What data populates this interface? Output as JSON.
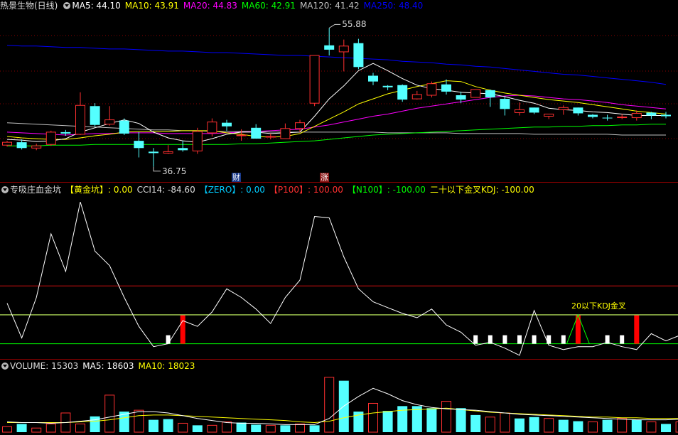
{
  "price_panel": {
    "title": "热景生物(日线)",
    "ma": [
      {
        "label": "MA5: 44.10",
        "color": "#ffffff"
      },
      {
        "label": "MA10: 43.91",
        "color": "#ffff00"
      },
      {
        "label": "MA20: 44.83",
        "color": "#ff00ff"
      },
      {
        "label": "MA60: 42.91",
        "color": "#00ff00"
      },
      {
        "label": "MA120: 41.42",
        "color": "#c0c0c0"
      },
      {
        "label": "MA250: 48.40",
        "color": "#0000ff"
      }
    ],
    "high_label": "55.88",
    "low_label": "36.75",
    "events": [
      {
        "text": "财",
        "color": "#3070ff"
      },
      {
        "text": "涨",
        "color": "#ff3030"
      }
    ]
  },
  "indicator_panel": {
    "title": "专吸庄血金坑",
    "items": [
      {
        "label": "【黄金坑】: 0.00",
        "color": "#ffff00"
      },
      {
        "label": "CCI14: -84.60",
        "color": "#dddddd"
      },
      {
        "label": "【ZERO】: 0.00",
        "color": "#00ccff"
      },
      {
        "label": "【P100】: 100.00",
        "color": "#ff3030"
      },
      {
        "label": "【N100】: -100.00",
        "color": "#00ff00"
      },
      {
        "label": "二十以下金叉KDJ: -100.00",
        "color": "#ffff00"
      }
    ],
    "annotation": "20以下KDJ金叉"
  },
  "volume_panel": {
    "title": "VOLUME: 15303",
    "ma5": "MA5: 18603",
    "ma10": "MA10: 18023"
  },
  "colors": {
    "up": "#ff3030",
    "down": "#54ffff",
    "bg": "#000000",
    "grid": "#8a0000"
  },
  "chart_data": [
    {
      "type": "candlestick",
      "candles": [
        [
          40.0,
          40.4,
          40.6,
          39.8
        ],
        [
          40.4,
          39.6,
          40.8,
          39.4
        ],
        [
          39.6,
          39.9,
          40.2,
          39.3
        ],
        [
          40.1,
          41.8,
          42.0,
          39.9
        ],
        [
          41.8,
          41.6,
          42.1,
          41.3
        ],
        [
          41.5,
          45.5,
          47.3,
          41.4
        ],
        [
          45.4,
          42.8,
          45.8,
          42.6
        ],
        [
          42.9,
          43.5,
          45.4,
          42.7
        ],
        [
          43.4,
          41.6,
          43.7,
          41.4
        ],
        [
          40.6,
          39.6,
          41.8,
          38.3
        ],
        [
          39.1,
          38.9,
          39.6,
          37.0
        ],
        [
          38.9,
          39.1,
          40.0,
          38.8
        ],
        [
          39.6,
          39.3,
          40.6,
          39.1
        ],
        [
          39.2,
          41.9,
          42.4,
          38.8
        ],
        [
          41.7,
          43.2,
          43.7,
          41.2
        ],
        [
          43.1,
          42.6,
          43.5,
          42.0
        ],
        [
          41.4,
          41.4,
          42.2,
          40.6
        ],
        [
          42.4,
          40.9,
          42.9,
          40.9
        ],
        [
          41.2,
          41.2,
          41.6,
          40.8
        ],
        [
          40.9,
          42.3,
          43.0,
          40.9
        ],
        [
          42.3,
          43.1,
          43.5,
          41.8
        ],
        [
          45.8,
          52.4,
          52.4,
          45.4
        ],
        [
          53.8,
          53.2,
          56.2,
          52.4
        ],
        [
          52.9,
          53.7,
          54.6,
          50.2
        ],
        [
          54.1,
          50.8,
          54.7,
          50.5
        ],
        [
          49.6,
          48.8,
          50.0,
          48.3
        ],
        [
          48.2,
          48.0,
          48.3,
          47.6
        ],
        [
          48.3,
          46.3,
          48.4,
          46.0
        ],
        [
          46.4,
          47.0,
          47.5,
          46.3
        ],
        [
          46.9,
          48.5,
          48.8,
          46.6
        ],
        [
          48.4,
          47.4,
          49.1,
          47.0
        ],
        [
          46.9,
          46.3,
          47.4,
          45.8
        ],
        [
          46.6,
          47.7,
          47.7,
          46.6
        ],
        [
          47.6,
          46.6,
          47.7,
          45.3
        ],
        [
          46.4,
          45.0,
          46.7,
          44.1
        ],
        [
          44.5,
          44.9,
          45.9,
          44.1
        ],
        [
          45.2,
          44.5,
          45.2,
          44.3
        ],
        [
          44.0,
          44.3,
          44.3,
          43.6
        ],
        [
          44.9,
          45.2,
          45.5,
          44.2
        ],
        [
          45.2,
          44.4,
          45.2,
          44.1
        ],
        [
          44.2,
          43.9,
          44.3,
          43.7
        ],
        [
          43.8,
          43.7,
          44.2,
          43.4
        ],
        [
          43.9,
          43.9,
          44.3,
          43.6
        ],
        [
          43.8,
          44.4,
          44.8,
          43.4
        ],
        [
          44.5,
          44.1,
          44.6,
          43.6
        ],
        [
          44.2,
          44.0,
          44.6,
          43.7
        ]
      ],
      "ma5": [
        40.8,
        40.7,
        40.5,
        40.6,
        40.9,
        41.8,
        42.4,
        43.0,
        43.5,
        43.0,
        41.8,
        41.0,
        40.6,
        40.4,
        40.9,
        41.5,
        41.8,
        41.8,
        41.6,
        41.7,
        41.8,
        44.0,
        46.4,
        48.2,
        50.3,
        51.3,
        50.3,
        49.2,
        48.3,
        47.8,
        47.6,
        47.3,
        47.2,
        47.1,
        46.7,
        46.2,
        45.8,
        45.1,
        44.9,
        44.8,
        44.6,
        44.5,
        44.3,
        44.1,
        44.1,
        44.1
      ],
      "ma10": [
        41.2,
        41.0,
        40.9,
        40.8,
        40.8,
        41.0,
        41.3,
        41.5,
        41.8,
        41.9,
        41.9,
        41.9,
        42.0,
        42.0,
        42.0,
        41.7,
        41.5,
        41.2,
        41.1,
        41.2,
        41.6,
        42.6,
        43.6,
        44.6,
        45.7,
        46.4,
        47.1,
        47.6,
        48.1,
        48.5,
        48.9,
        48.8,
        48.1,
        47.6,
        47.2,
        46.9,
        46.6,
        46.3,
        46.1,
        45.9,
        45.6,
        45.3,
        45.0,
        44.7,
        44.5,
        44.3
      ],
      "ma20": [
        41.8,
        41.7,
        41.6,
        41.5,
        41.4,
        41.5,
        41.6,
        41.6,
        41.7,
        41.7,
        41.7,
        41.6,
        41.6,
        41.6,
        41.6,
        41.7,
        41.8,
        41.9,
        42.0,
        42.1,
        42.2,
        42.5,
        42.8,
        43.2,
        43.6,
        44.0,
        44.3,
        44.7,
        45.1,
        45.4,
        45.7,
        46.0,
        46.3,
        46.6,
        46.8,
        46.9,
        46.8,
        46.6,
        46.4,
        46.3,
        46.1,
        45.9,
        45.6,
        45.4,
        45.2,
        45.0
      ],
      "ma60": [
        39.9,
        39.9,
        39.9,
        40.0,
        40.0,
        40.0,
        40.1,
        40.1,
        40.1,
        40.1,
        40.1,
        40.1,
        40.1,
        40.1,
        40.1,
        40.1,
        40.2,
        40.2,
        40.3,
        40.4,
        40.5,
        40.6,
        40.8,
        41.0,
        41.2,
        41.4,
        41.5,
        41.6,
        41.7,
        41.8,
        41.9,
        42.0,
        42.1,
        42.2,
        42.3,
        42.4,
        42.5,
        42.5,
        42.6,
        42.6,
        42.7,
        42.7,
        42.8,
        42.8,
        42.9,
        42.9
      ],
      "ma120": [
        43.1,
        43.0,
        42.9,
        42.8,
        42.7,
        42.6,
        42.5,
        42.4,
        42.3,
        42.2,
        42.1,
        42.1,
        42.0,
        42.0,
        41.9,
        41.9,
        41.9,
        41.9,
        41.8,
        41.8,
        41.8,
        41.8,
        41.8,
        41.8,
        41.8,
        41.8,
        41.7,
        41.7,
        41.7,
        41.7,
        41.7,
        41.6,
        41.6,
        41.6,
        41.6,
        41.6,
        41.5,
        41.5,
        41.5,
        41.5,
        41.5,
        41.5,
        41.4,
        41.4,
        41.4,
        41.4
      ],
      "ma250": [
        53.8,
        53.7,
        53.7,
        53.6,
        53.5,
        53.5,
        53.4,
        53.3,
        53.3,
        53.2,
        53.1,
        53.0,
        53.0,
        52.9,
        52.8,
        52.8,
        52.7,
        52.6,
        52.5,
        52.4,
        52.4,
        52.3,
        52.2,
        52.1,
        52.0,
        51.9,
        51.8,
        51.6,
        51.5,
        51.4,
        51.2,
        51.1,
        50.9,
        50.8,
        50.6,
        50.4,
        50.2,
        50.0,
        49.8,
        49.7,
        49.5,
        49.3,
        49.1,
        48.9,
        48.7,
        48.4
      ],
      "ylim": [
        35.5,
        58.3
      ]
    },
    {
      "type": "line",
      "name": "CCI14",
      "values": [
        40,
        -80,
        60,
        280,
        150,
        390,
        220,
        170,
        60,
        -40,
        -110,
        -100,
        -20,
        -40,
        10,
        90,
        60,
        20,
        -30,
        60,
        120,
        340,
        335,
        200,
        90,
        45,
        25,
        5,
        -10,
        20,
        -35,
        -60,
        -105,
        -95,
        -115,
        -140,
        15,
        -105,
        -120,
        -110,
        -110,
        -95,
        -110,
        -120,
        -65,
        -90,
        -70
      ],
      "ylim": [
        -150,
        410
      ],
      "reference_lines": [
        100,
        0,
        -100
      ],
      "white_bars_at": [
        11,
        32,
        33,
        34,
        35,
        36,
        37,
        38,
        41,
        42
      ],
      "red_bars_at": [
        12,
        39,
        43
      ]
    },
    {
      "type": "bar",
      "name": "VOLUME",
      "values": [
        8,
        12,
        6,
        12,
        28,
        12,
        23,
        54,
        30,
        32,
        18,
        19,
        13,
        10,
        10,
        15,
        14,
        11,
        10,
        10,
        12,
        10,
        80,
        75,
        30,
        42,
        31,
        38,
        38,
        35,
        45,
        35,
        25,
        22,
        28,
        20,
        22,
        20,
        18,
        16,
        15,
        18,
        20,
        18,
        15,
        12,
        15
      ],
      "up": [
        1,
        0,
        1,
        1,
        1,
        1,
        0,
        1,
        0,
        1,
        0,
        0,
        1,
        0,
        1,
        1,
        0,
        0,
        1,
        0,
        1,
        0,
        1,
        0,
        0,
        1,
        0,
        0,
        0,
        0,
        1,
        0,
        0,
        1,
        1,
        0,
        0,
        1,
        0,
        0,
        1,
        0,
        1,
        0,
        1,
        0,
        1
      ],
      "ma5": [
        15,
        14,
        14,
        13,
        14,
        16,
        18,
        22,
        26,
        30,
        30,
        28,
        24,
        20,
        17,
        14,
        13,
        13,
        12,
        11,
        11,
        11,
        20,
        38,
        52,
        64,
        56,
        46,
        40,
        36,
        34,
        33,
        32,
        30,
        28,
        26,
        25,
        24,
        23,
        22,
        21,
        20,
        19,
        18,
        18,
        18,
        19
      ],
      "ma10": [
        14,
        14,
        14,
        14,
        14,
        15,
        16,
        18,
        21,
        24,
        25,
        25,
        24,
        23,
        22,
        21,
        20,
        19,
        18,
        17,
        15,
        14,
        16,
        21,
        25,
        28,
        30,
        32,
        33,
        34,
        35,
        33,
        31,
        29,
        28,
        27,
        26,
        25,
        24,
        23,
        22,
        22,
        21,
        21,
        20,
        20,
        20
      ]
    }
  ]
}
